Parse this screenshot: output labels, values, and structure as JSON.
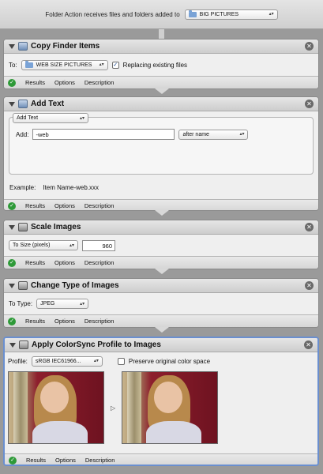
{
  "header": {
    "label": "Folder Action receives files and folders added to",
    "folder": "BIG PICTURES"
  },
  "actions": {
    "copy": {
      "title": "Copy Finder Items",
      "to_label": "To:",
      "to_value": "WEB SIZE PICTURES",
      "replace_label": "Replacing existing files",
      "replace_checked": true
    },
    "add_text": {
      "title": "Add Text",
      "mode": "Add Text",
      "add_label": "Add:",
      "add_value": "-web",
      "position": "after name",
      "example_label": "Example:",
      "example_value": "Item Name-web.xxx"
    },
    "scale": {
      "title": "Scale Images",
      "mode": "To Size (pixels)",
      "size": "960"
    },
    "change_type": {
      "title": "Change Type of Images",
      "type_label": "To Type:",
      "type_value": "JPEG"
    },
    "colorsync": {
      "title": "Apply ColorSync Profile to Images",
      "profile_label": "Profile:",
      "profile_value": "sRGB IEC61966...",
      "preserve_label": "Preserve original color space",
      "preserve_checked": false
    }
  },
  "footer": {
    "results": "Results",
    "options": "Options",
    "description": "Description"
  },
  "icons": {
    "close": "close-icon",
    "check": "checkmark-icon",
    "folder": "folder-icon",
    "disclosure": "disclosure-triangle-icon"
  },
  "colors": {
    "success_green": "#2e9a38",
    "selection_blue": "#6a8fd0",
    "folder_blue": "#7aa3d6"
  }
}
